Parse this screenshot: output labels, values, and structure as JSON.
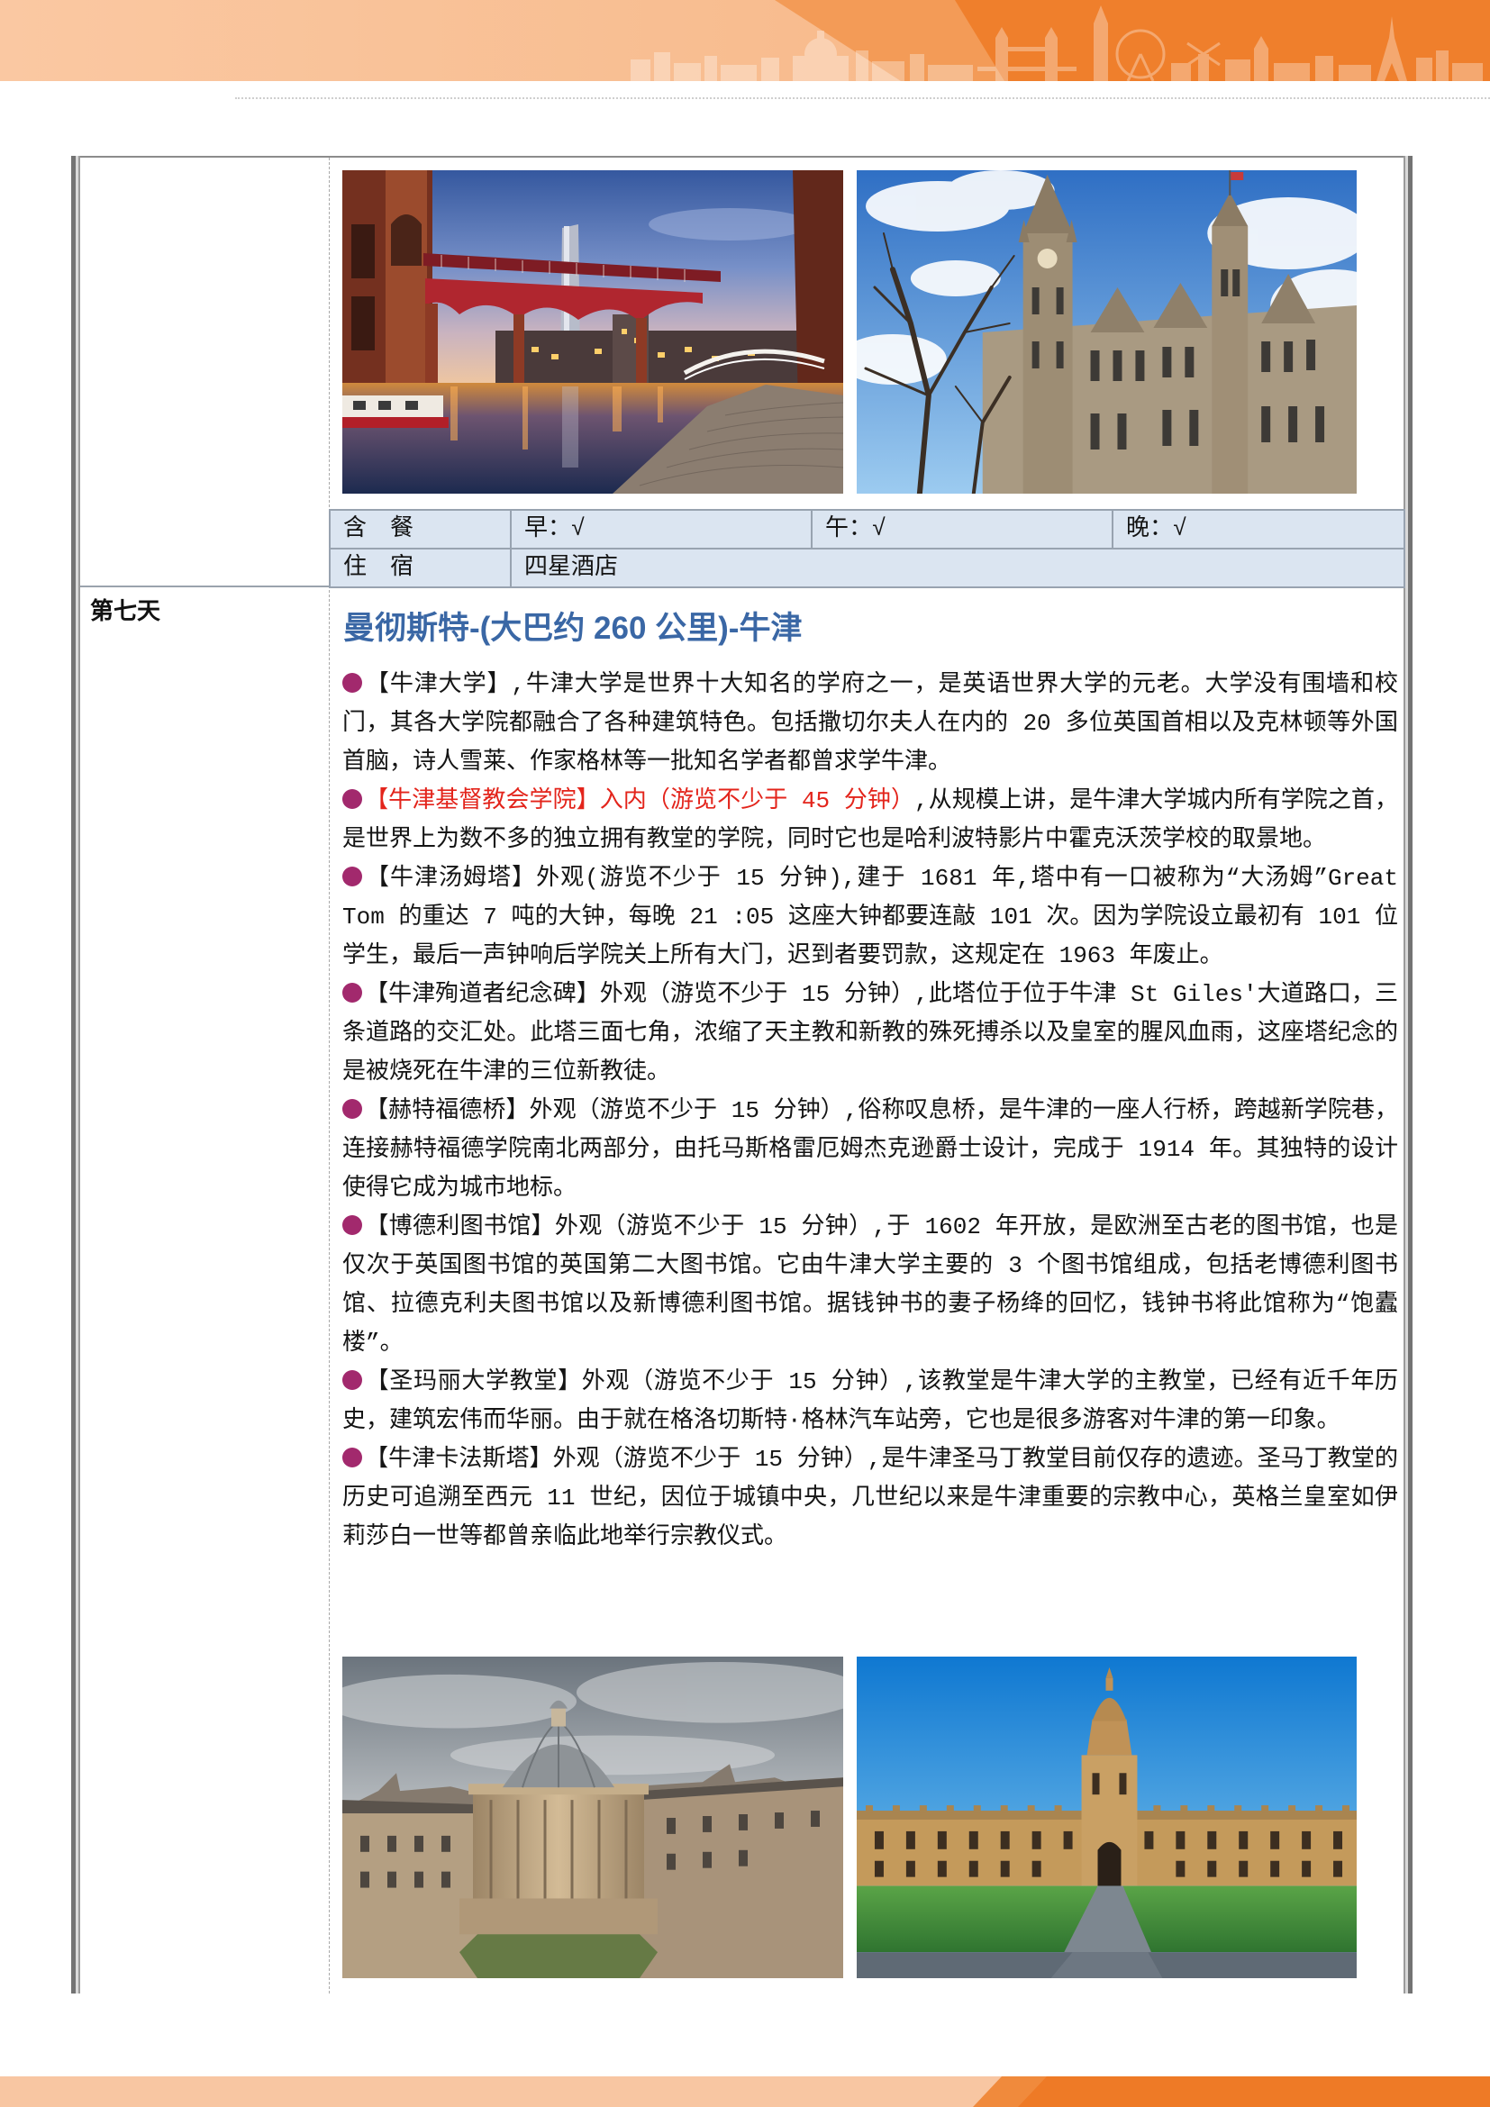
{
  "colors": {
    "title_blue": "#3a67a5",
    "highlight_red": "#e3241b",
    "bullet_purple": "#a2296d",
    "meal_row_bg": "#dbe5f1",
    "accent_orange": "#ef7f2c"
  },
  "icons": {
    "bullet": "bullet-icon"
  },
  "meals": {
    "label": "含　餐",
    "breakfast": "早：√",
    "lunch": "午：√",
    "dinner": "晚：√"
  },
  "lodging": {
    "label": "住　宿",
    "value": "四星酒店"
  },
  "day7": {
    "label": "第七天",
    "route_title": "曼彻斯特-(大巴约 260 公里)-牛津",
    "items": [
      {
        "title": "【牛津大学】",
        "highlight": false,
        "text": ",牛津大学是世界十大知名的学府之一，是英语世界大学的元老。大学没有围墙和校门，其各大学院都融合了各种建筑特色。包括撒切尔夫人在内的 20 多位英国首相以及克林顿等外国首脑，诗人雪莱、作家格林等一批知名学者都曾求学牛津。"
      },
      {
        "title": "【牛津基督教会学院】入内（游览不少于 45 分钟）",
        "highlight": true,
        "text": ",从规模上讲，是牛津大学城内所有学院之首，是世界上为数不多的独立拥有教堂的学院，同时它也是哈利波特影片中霍克沃茨学校的取景地。"
      },
      {
        "title": "【牛津汤姆塔】",
        "highlight": false,
        "text": "外观(游览不少于 15 分钟),建于 1681 年,塔中有一口被称为“大汤姆”Great Tom 的重达 7 吨的大钟，每晚 21 :05 这座大钟都要连敲 101 次。因为学院设立最初有 101 位学生，最后一声钟响后学院关上所有大门，迟到者要罚款，这规定在 1963 年废止。"
      },
      {
        "title": "【牛津殉道者纪念碑】",
        "highlight": false,
        "text": "外观（游览不少于 15 分钟）,此塔位于位于牛津 St Giles'大道路口，三条道路的交汇处。此塔三面七角，浓缩了天主教和新教的殊死搏杀以及皇室的腥风血雨，这座塔纪念的是被烧死在牛津的三位新教徒。"
      },
      {
        "title": "【赫特福德桥】",
        "highlight": false,
        "text": "外观（游览不少于 15 分钟）,俗称叹息桥，是牛津的一座人行桥，跨越新学院巷，连接赫特福德学院南北两部分，由托马斯格雷厄姆杰克逊爵士设计，完成于 1914 年。其独特的设计使得它成为城市地标。"
      },
      {
        "title": "【博德利图书馆】",
        "highlight": false,
        "text": "外观（游览不少于 15 分钟）,于 1602 年开放，是欧洲至古老的图书馆，也是仅次于英国图书馆的英国第二大图书馆。它由牛津大学主要的 3 个图书馆组成，包括老博德利图书馆、拉德克利夫图书馆以及新博德利图书馆。据钱钟书的妻子杨绛的回忆，钱钟书将此馆称为“饱蠹楼”。"
      },
      {
        "title": "【圣玛丽大学教堂】",
        "highlight": false,
        "text": "外观（游览不少于 15 分钟）,该教堂是牛津大学的主教堂，已经有近千年历史，建筑宏伟而华丽。由于就在格洛切斯特·格林汽车站旁，它也是很多游客对牛津的第一印象。"
      },
      {
        "title": "【牛津卡法斯塔】",
        "highlight": false,
        "text": "外观（游览不少于 15 分钟）,是牛津圣马丁教堂目前仅存的遗迹。圣马丁教堂的历史可追溯至西元 11 世纪，因位于城镇中央，几世纪以来是牛津重要的宗教中心，英格兰皇室如伊莉莎白一世等都曾亲临此地举行宗教仪式。"
      }
    ]
  }
}
